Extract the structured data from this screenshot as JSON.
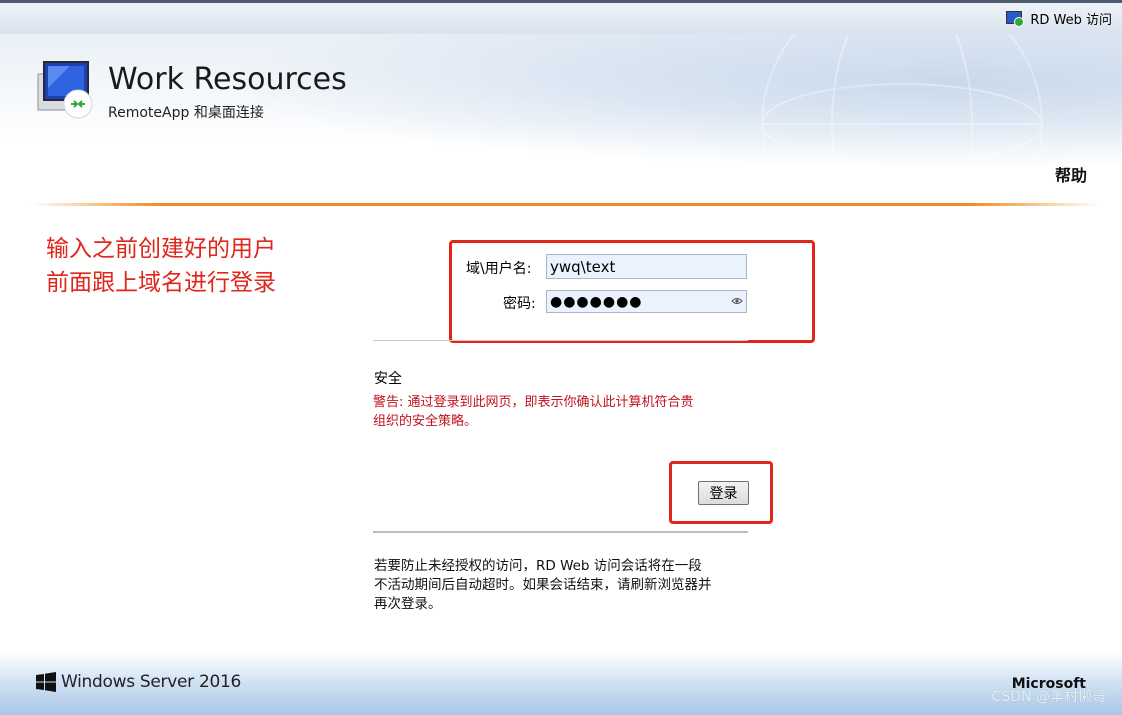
{
  "topbar": {
    "rd_web_link": "RD Web 访问"
  },
  "header": {
    "title": "Work Resources",
    "subtitle": "RemoteApp 和桌面连接",
    "help": "帮助"
  },
  "annotation": {
    "line1": "输入之前创建好的用户",
    "line2": "前面跟上域名进行登录"
  },
  "form": {
    "username_label": "域\\用户名:",
    "username_value": "ywq\\text",
    "password_label": "密码:",
    "password_value": "●●●●●●●"
  },
  "security": {
    "title": "安全",
    "warning_line1": "警告: 通过登录到此网页，即表示你确认此计算机符合贵",
    "warning_line2": "组织的安全策略。"
  },
  "login_button": "登录",
  "timeout_note": {
    "line1": "若要防止未经授权的访问，RD Web 访问会话将在一段",
    "line2": "不活动期间后自动超时。如果会话结束，请刷新浏览器并",
    "line3": "再次登录。"
  },
  "footer": {
    "windows_server": "Windows Server 2016",
    "microsoft": "Microsoft",
    "watermark": "CSDN @羊村懒哥"
  },
  "colors": {
    "annotation_red": "#e0261a",
    "accent_orange": "#f38c1e",
    "warning_red": "#c1121c"
  }
}
